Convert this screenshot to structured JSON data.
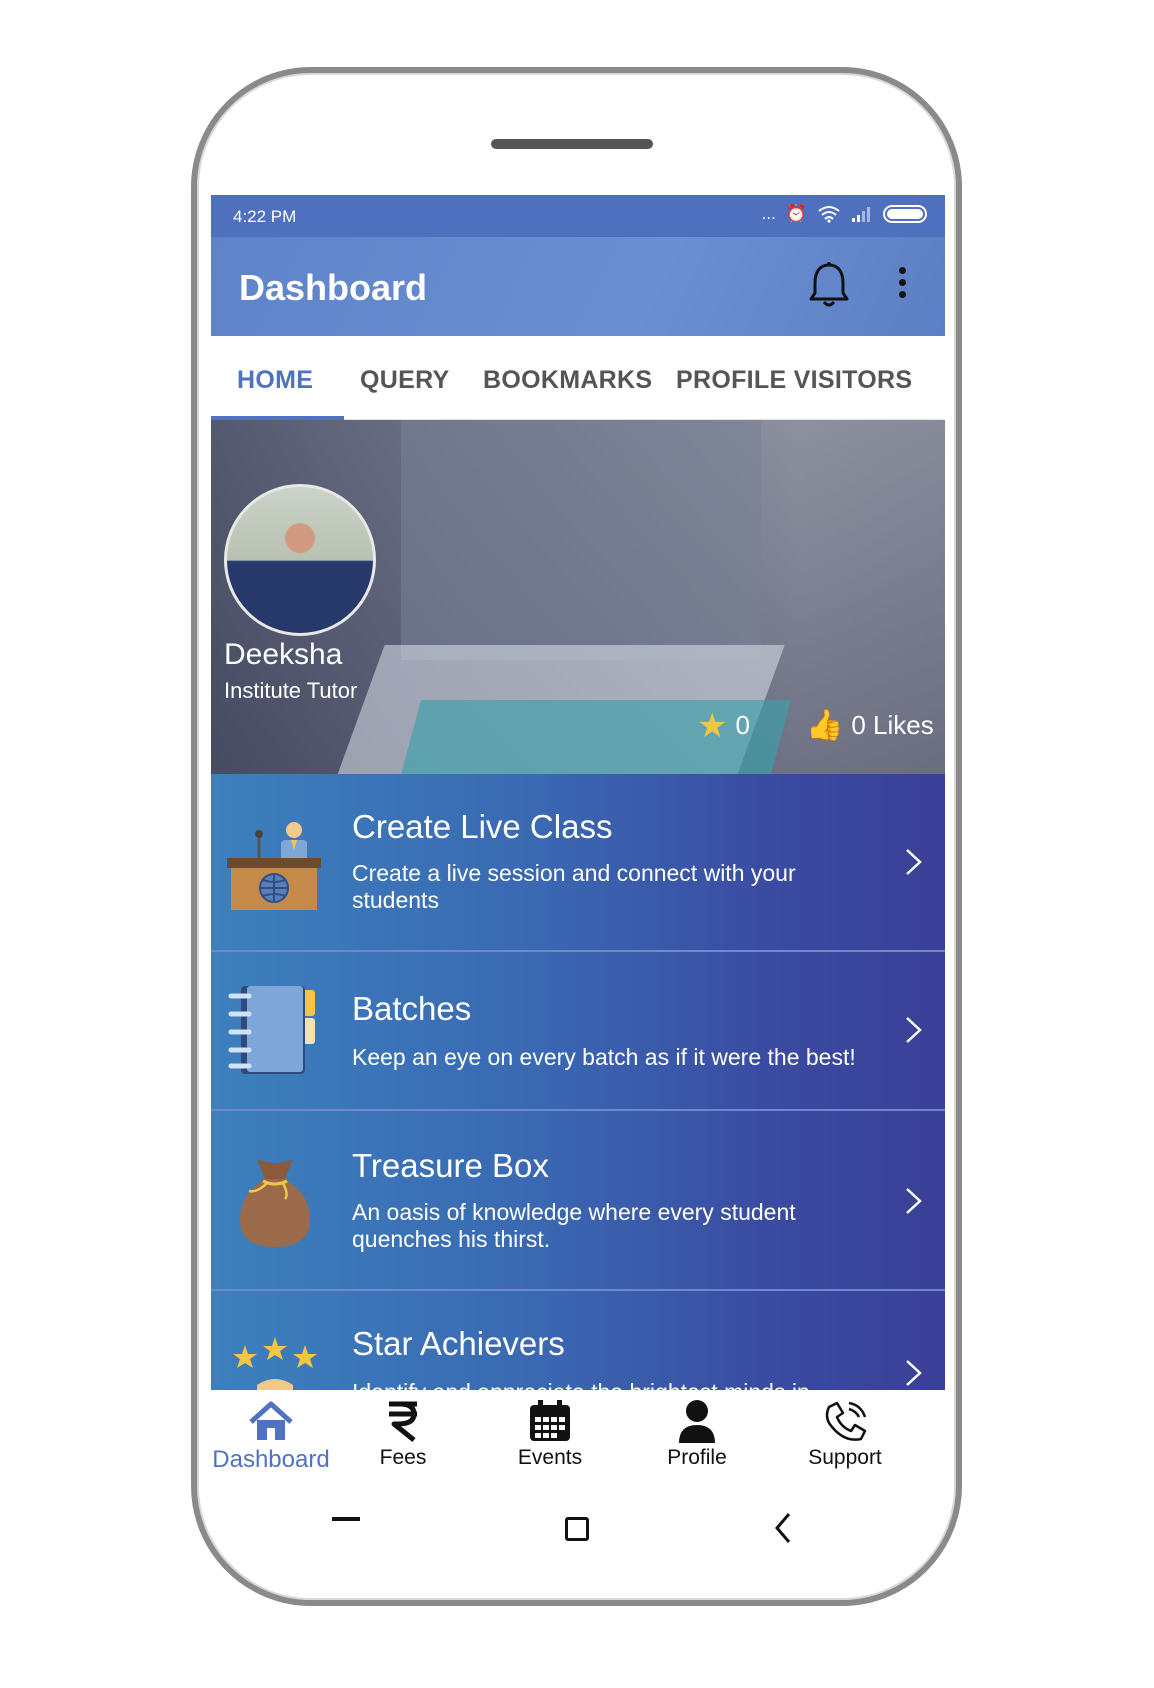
{
  "status": {
    "time": "4:22 PM",
    "dots": "...",
    "alarm_icon": "alarm-icon",
    "wifi_icon": "wifi-icon",
    "signal_icon": "signal-icon",
    "battery_icon": "battery-icon"
  },
  "appbar": {
    "title": "Dashboard",
    "bell_icon": "bell-icon",
    "menu_icon": "more-vertical-icon"
  },
  "tabs": [
    {
      "label": "HOME",
      "active": true
    },
    {
      "label": "QUERY",
      "active": false
    },
    {
      "label": "BOOKMARKS",
      "active": false
    },
    {
      "label": "PROFILE VISITORS",
      "active": false
    }
  ],
  "profile": {
    "name": "Deeksha",
    "role": "Institute Tutor",
    "stars": "0",
    "likes": "0 Likes"
  },
  "items": [
    {
      "title": "Create Live Class",
      "desc": "Create a live session and connect with your students",
      "icon": "podium-icon"
    },
    {
      "title": "Batches",
      "desc": "Keep an eye on every batch as if it were the best!",
      "icon": "notebook-icon"
    },
    {
      "title": "Treasure Box",
      "desc": "An oasis of knowledge where every student quenches his thirst.",
      "icon": "money-bag-icon"
    },
    {
      "title": "Star Achievers",
      "desc": "Identify and appreciate the brightest minds in",
      "icon": "stars-icon"
    }
  ],
  "bottom_nav": [
    {
      "label": "Dashboard",
      "icon": "home-icon",
      "active": true
    },
    {
      "label": "Fees",
      "icon": "rupee-icon",
      "active": false
    },
    {
      "label": "Events",
      "icon": "calendar-icon",
      "active": false
    },
    {
      "label": "Profile",
      "icon": "person-icon",
      "active": false
    },
    {
      "label": "Support",
      "icon": "phone-icon",
      "active": false
    }
  ],
  "colors": {
    "primary": "#4f73c0",
    "appbar": "#6a8fd2",
    "card_start": "#3c80bd",
    "card_end": "#3a3f97"
  }
}
